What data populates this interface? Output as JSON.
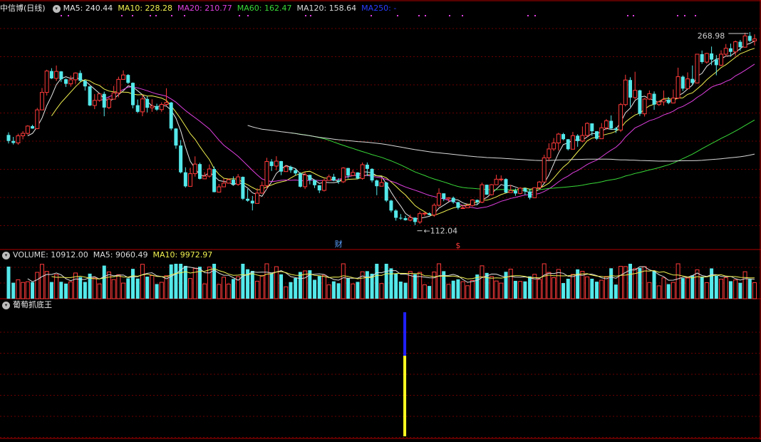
{
  "main_panel": {
    "stock_title": "中信博(日线)",
    "ma_legend": [
      {
        "label": "MA5: 240.44",
        "color": "#e6e6e6"
      },
      {
        "label": "MA10: 228.28",
        "color": "#f0f050"
      },
      {
        "label": "MA20: 210.77",
        "color": "#e040e0"
      },
      {
        "label": "MA60: 162.47",
        "color": "#38d838"
      },
      {
        "label": "MA120: 158.64",
        "color": "#d8d8d8"
      },
      {
        "label": "MA250: -",
        "color": "#2a3cff"
      }
    ],
    "high_label": "268.98",
    "low_label": "112.04",
    "marker_cai": "财",
    "marker_s": "$"
  },
  "volume_panel": {
    "legend": [
      {
        "label": "VOLUME: 10912.00",
        "color": "#dcdcdc"
      },
      {
        "label": "MA5: 9060.49",
        "color": "#dcdcdc"
      },
      {
        "label": "MA10: 9972.97",
        "color": "#f0f050"
      }
    ]
  },
  "indicator_panel": {
    "title": "葡萄抓底王"
  },
  "colors": {
    "up": "#ff3a3a",
    "down": "#54e8ea",
    "grid": "#6b0000",
    "frame": "#b00000",
    "signal_top": "#2020ff",
    "signal_bottom": "#ffff20"
  },
  "chart_data": {
    "type": "candlestick",
    "price_range": [
      95,
      280
    ],
    "high": 268.98,
    "low": 112.04,
    "candles": [
      [
        185.3,
        180.4,
        187.4,
        178.4
      ],
      [
        180.4,
        178.8,
        183.7,
        177.5
      ],
      [
        178.8,
        184.6,
        186.3,
        177.3
      ],
      [
        184.6,
        186.6,
        188.4,
        181.7
      ],
      [
        186.6,
        192.5,
        193.2,
        185.6
      ],
      [
        192.5,
        190.5,
        193.6,
        190.3
      ],
      [
        190.5,
        205.7,
        207.3,
        190.0
      ],
      [
        205.7,
        219.9,
        223.5,
        205.7
      ],
      [
        219.9,
        237.3,
        238.4,
        217.4
      ],
      [
        237.3,
        231.3,
        239.6,
        230.8
      ],
      [
        231.3,
        237.0,
        241.8,
        229.2
      ],
      [
        237.0,
        230.6,
        237.3,
        228.3
      ],
      [
        230.6,
        226.9,
        231.2,
        224.3
      ],
      [
        226.9,
        230.2,
        233.6,
        224.6
      ],
      [
        230.2,
        235.7,
        236.2,
        226.9
      ],
      [
        235.7,
        229.4,
        237.8,
        228.3
      ],
      [
        229.4,
        224.8,
        230.0,
        221.4
      ],
      [
        224.8,
        209.3,
        225.0,
        208.7
      ],
      [
        209.3,
        213.4,
        218.5,
        206.3
      ],
      [
        213.4,
        218.7,
        218.7,
        212.4
      ],
      [
        218.7,
        207.6,
        220.5,
        200.5
      ],
      [
        207.6,
        214.4,
        215.8,
        206.3
      ],
      [
        214.4,
        219.5,
        225.2,
        214.3
      ],
      [
        219.5,
        230.5,
        232.7,
        215.9
      ],
      [
        230.5,
        234.1,
        237.8,
        230.1
      ],
      [
        234.1,
        227.7,
        234.8,
        226.7
      ],
      [
        227.7,
        209.5,
        228.0,
        206.9
      ],
      [
        209.5,
        204.1,
        214.1,
        203.0
      ],
      [
        204.1,
        214.6,
        217.9,
        200.5
      ],
      [
        214.6,
        207.4,
        216.8,
        203.6
      ],
      [
        207.4,
        208.8,
        214.3,
        204.1
      ],
      [
        208.8,
        205.9,
        210.7,
        204.9
      ],
      [
        205.9,
        210.1,
        211.8,
        204.1
      ],
      [
        210.1,
        211.7,
        223.3,
        208.9
      ],
      [
        211.7,
        190.5,
        212.2,
        189.0
      ],
      [
        190.5,
        176.7,
        190.9,
        174.1
      ],
      [
        176.7,
        154.9,
        181.1,
        154.0
      ],
      [
        154.9,
        143.5,
        159.0,
        142.5
      ],
      [
        143.5,
        153.8,
        158.6,
        150.2
      ],
      [
        153.8,
        161.6,
        167.9,
        151.4
      ],
      [
        161.6,
        149.6,
        162.7,
        149.1
      ],
      [
        149.6,
        151.8,
        155.0,
        150.6
      ],
      [
        151.8,
        157.6,
        161.3,
        150.6
      ],
      [
        157.6,
        138.8,
        159.6,
        138.6
      ],
      [
        138.8,
        143.1,
        145.4,
        141.6
      ],
      [
        143.1,
        146.1,
        149.7,
        143.7
      ],
      [
        146.1,
        148.9,
        149.9,
        145.7
      ],
      [
        148.9,
        145.1,
        151.6,
        144.0
      ],
      [
        145.1,
        151.2,
        153.5,
        143.9
      ],
      [
        151.2,
        133.4,
        151.5,
        132.4
      ],
      [
        133.4,
        131.8,
        141.4,
        131.0
      ],
      [
        131.8,
        129.6,
        135.7,
        123.9
      ],
      [
        129.6,
        138.0,
        141.9,
        136.1
      ],
      [
        138.0,
        144.1,
        147.4,
        137.5
      ],
      [
        144.1,
        163.7,
        166.7,
        141.0
      ],
      [
        163.7,
        160.0,
        165.6,
        156.0
      ],
      [
        160.0,
        164.0,
        168.0,
        156.6
      ],
      [
        164.0,
        155.5,
        164.2,
        152.6
      ],
      [
        155.5,
        159.4,
        160.7,
        158.3
      ],
      [
        159.4,
        156.6,
        160.4,
        154.5
      ],
      [
        156.6,
        154.0,
        158.0,
        152.3
      ],
      [
        154.0,
        143.2,
        154.9,
        142.6
      ],
      [
        143.2,
        152.8,
        155.2,
        141.3
      ],
      [
        152.8,
        148.6,
        152.9,
        145.1
      ],
      [
        148.6,
        144.4,
        149.1,
        142.1
      ],
      [
        144.4,
        140.2,
        144.5,
        138.0
      ],
      [
        140.2,
        148.3,
        149.7,
        139.3
      ],
      [
        148.3,
        151.3,
        153.1,
        149.4
      ],
      [
        151.3,
        148.2,
        153.7,
        147.6
      ],
      [
        148.2,
        147.2,
        150.1,
        145.4
      ],
      [
        147.2,
        158.4,
        159.1,
        146.2
      ],
      [
        158.4,
        152.3,
        158.5,
        149.9
      ],
      [
        152.3,
        154.8,
        157.0,
        152.5
      ],
      [
        154.8,
        149.9,
        155.0,
        149.2
      ],
      [
        149.9,
        161.1,
        162.9,
        148.9
      ],
      [
        161.1,
        157.7,
        162.9,
        151.9
      ],
      [
        157.7,
        148.3,
        158.2,
        146.7
      ],
      [
        148.3,
        143.6,
        149.0,
        136.3
      ],
      [
        143.6,
        146.6,
        149.9,
        145.4
      ],
      [
        146.6,
        131.9,
        147.2,
        130.7
      ],
      [
        131.9,
        123.8,
        132.6,
        122.3
      ],
      [
        123.8,
        117.9,
        124.8,
        115.6
      ],
      [
        117.9,
        117.6,
        121.0,
        116.3
      ],
      [
        117.6,
        116.0,
        119.6,
        115.6
      ],
      [
        116.0,
        118.0,
        120.5,
        115.0
      ],
      [
        118.0,
        114.5,
        118.3,
        112.0
      ],
      [
        114.5,
        121.3,
        123.1,
        112.9
      ],
      [
        121.3,
        121.6,
        122.3,
        119.3
      ],
      [
        121.6,
        120.2,
        122.3,
        120.0
      ],
      [
        120.2,
        128.1,
        129.7,
        118.7
      ],
      [
        128.1,
        137.8,
        141.9,
        126.9
      ],
      [
        137.8,
        133.3,
        137.8,
        131.4
      ],
      [
        133.3,
        134.2,
        134.7,
        131.1
      ],
      [
        134.2,
        130.6,
        135.2,
        129.4
      ],
      [
        130.6,
        126.0,
        131.0,
        124.6
      ],
      [
        126.0,
        126.0,
        127.8,
        125.3
      ],
      [
        126.0,
        127.9,
        129.4,
        126.8
      ],
      [
        127.9,
        132.4,
        133.1,
        127.1
      ],
      [
        132.4,
        130.6,
        132.8,
        128.6
      ],
      [
        130.6,
        144.8,
        146.5,
        129.8
      ],
      [
        144.8,
        136.7,
        144.9,
        136.5
      ],
      [
        136.7,
        144.8,
        145.4,
        136.1
      ],
      [
        144.8,
        149.3,
        152.9,
        146.5
      ],
      [
        149.3,
        149.4,
        152.4,
        147.5
      ],
      [
        149.4,
        138.4,
        150.1,
        138.1
      ],
      [
        138.4,
        140.0,
        144.6,
        139.3
      ],
      [
        140.0,
        137.7,
        141.8,
        135.8
      ],
      [
        137.7,
        142.0,
        142.8,
        137.0
      ],
      [
        142.0,
        139.3,
        142.3,
        136.6
      ],
      [
        139.3,
        134.2,
        141.5,
        132.8
      ],
      [
        134.2,
        142.4,
        142.5,
        134.7
      ],
      [
        142.4,
        147.0,
        147.9,
        140.5
      ],
      [
        147.0,
        166.7,
        169.2,
        147.7
      ],
      [
        166.7,
        173.9,
        178.5,
        163.9
      ],
      [
        173.9,
        178.8,
        182.8,
        172.3
      ],
      [
        178.8,
        186.0,
        187.0,
        172.5
      ],
      [
        186.0,
        181.8,
        187.0,
        181.0
      ],
      [
        181.8,
        173.7,
        182.0,
        172.7
      ],
      [
        173.7,
        184.7,
        187.8,
        174.1
      ],
      [
        184.7,
        180.3,
        185.9,
        175.7
      ],
      [
        180.3,
        184.9,
        192.2,
        179.4
      ],
      [
        184.9,
        194.7,
        195.6,
        183.4
      ],
      [
        194.7,
        188.3,
        194.7,
        184.6
      ],
      [
        188.3,
        182.2,
        188.4,
        181.2
      ],
      [
        182.2,
        191.1,
        195.0,
        186.1
      ],
      [
        191.1,
        196.8,
        198.3,
        189.6
      ],
      [
        196.8,
        190.6,
        201.2,
        189.4
      ],
      [
        190.6,
        189.3,
        191.8,
        186.9
      ],
      [
        189.3,
        210.0,
        211.4,
        187.7
      ],
      [
        210.0,
        230.0,
        234.3,
        208.6
      ],
      [
        230.0,
        215.7,
        232.2,
        208.2
      ],
      [
        215.7,
        221.6,
        236.7,
        214.1
      ],
      [
        221.6,
        202.5,
        222.1,
        200.7
      ],
      [
        202.5,
        214.5,
        215.3,
        200.3
      ],
      [
        214.5,
        218.8,
        221.5,
        213.7
      ],
      [
        218.8,
        210.0,
        220.7,
        205.7
      ],
      [
        210.0,
        212.2,
        213.1,
        208.9
      ],
      [
        212.2,
        214.0,
        221.5,
        209.1
      ],
      [
        214.0,
        211.3,
        216.2,
        210.3
      ],
      [
        211.3,
        215.3,
        222.3,
        214.5
      ],
      [
        215.3,
        232.7,
        240.0,
        214.5
      ],
      [
        232.7,
        223.0,
        233.7,
        221.1
      ],
      [
        223.0,
        230.9,
        236.2,
        223.0
      ],
      [
        230.9,
        227.6,
        241.8,
        225.9
      ],
      [
        227.6,
        251.0,
        251.3,
        227.2
      ],
      [
        251.0,
        244.6,
        254.0,
        243.2
      ],
      [
        244.6,
        251.6,
        252.1,
        243.3
      ],
      [
        251.6,
        246.6,
        257.2,
        242.1
      ],
      [
        246.6,
        242.1,
        250.3,
        233.8
      ],
      [
        242.1,
        251.0,
        254.2,
        241.2
      ],
      [
        251.0,
        255.8,
        259.3,
        249.3
      ],
      [
        255.8,
        252.9,
        259.6,
        249.0
      ],
      [
        252.9,
        261.1,
        262.1,
        249.6
      ],
      [
        261.1,
        256.7,
        262.6,
        253.8
      ],
      [
        256.7,
        265.9,
        268.5,
        256.4
      ],
      [
        265.9,
        261.8,
        269.0,
        260.8
      ],
      [
        261.8,
        263.4,
        267.2,
        258.0
      ]
    ],
    "volume": [
      {
        "label": "VOLUME",
        "value": 10912.0
      },
      {
        "label": "MA5",
        "value": 9060.49
      },
      {
        "label": "MA10",
        "value": 9972.97
      }
    ],
    "signal": {
      "name": "葡萄抓底王",
      "bar_index": 83
    }
  }
}
